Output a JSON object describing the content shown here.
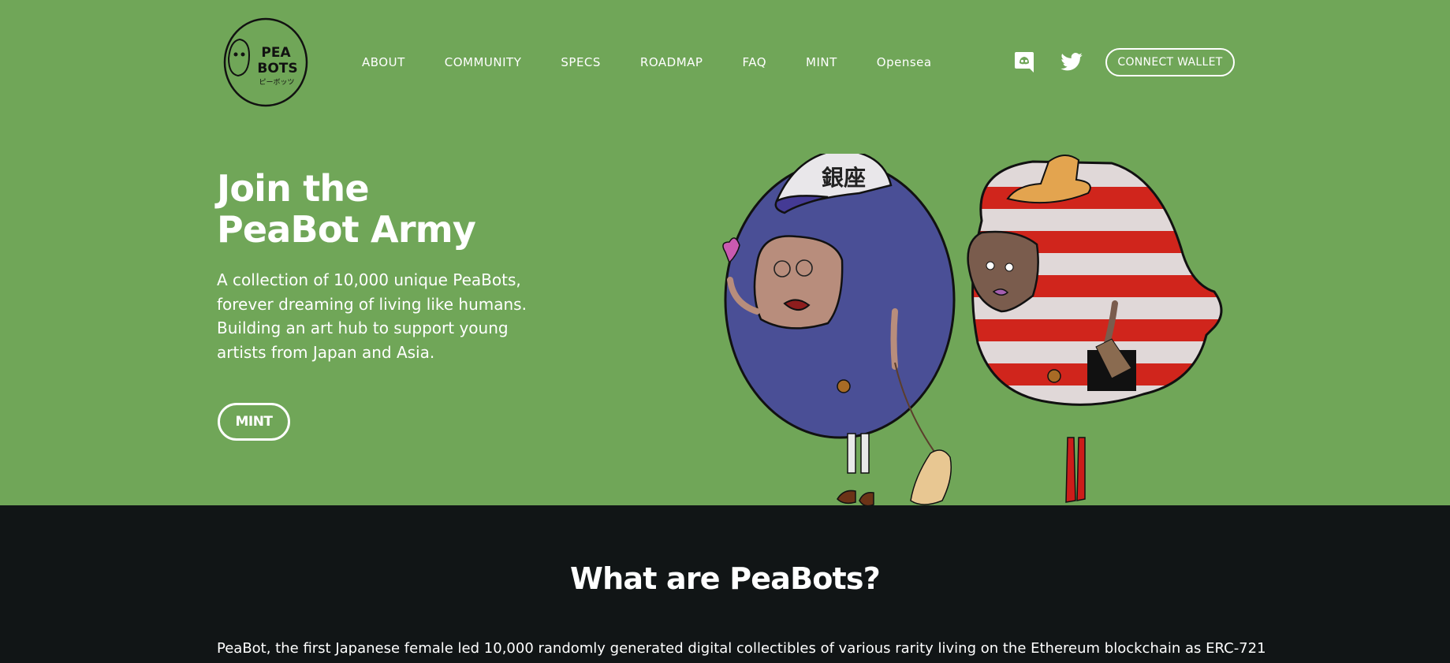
{
  "brand": {
    "logo_line1": "PEA",
    "logo_line2": "BOTS",
    "logo_kana": "ピーボッツ"
  },
  "nav": {
    "items": [
      {
        "label": "ABOUT"
      },
      {
        "label": "COMMUNITY"
      },
      {
        "label": "SPECS"
      },
      {
        "label": "ROADMAP"
      },
      {
        "label": "FAQ"
      },
      {
        "label": "MINT"
      },
      {
        "label": "Opensea"
      }
    ],
    "icons": [
      "discord-icon",
      "twitter-icon"
    ],
    "connect_wallet_label": "CONNECT WALLET"
  },
  "hero": {
    "title_line1": "Join the",
    "title_line2": "PeaBot Army",
    "description_lines": [
      "A collection of 10,000 unique PeaBots,",
      "forever dreaming of living like humans.",
      "Building an art hub to support young",
      "artists from Japan and Asia."
    ],
    "mint_label": "MINT",
    "cap_text": "銀座"
  },
  "about": {
    "title": "What are PeaBots?",
    "text": "PeaBot, the first Japanese female led 10,000 randomly generated digital collectibles of various rarity living on the Ethereum blockchain as ERC-721"
  },
  "colors": {
    "hero_bg": "#70a658",
    "dark_bg": "#111516",
    "text": "#ffffff",
    "blue_body": "#4a4f96",
    "stripe_red": "#d0251c"
  }
}
